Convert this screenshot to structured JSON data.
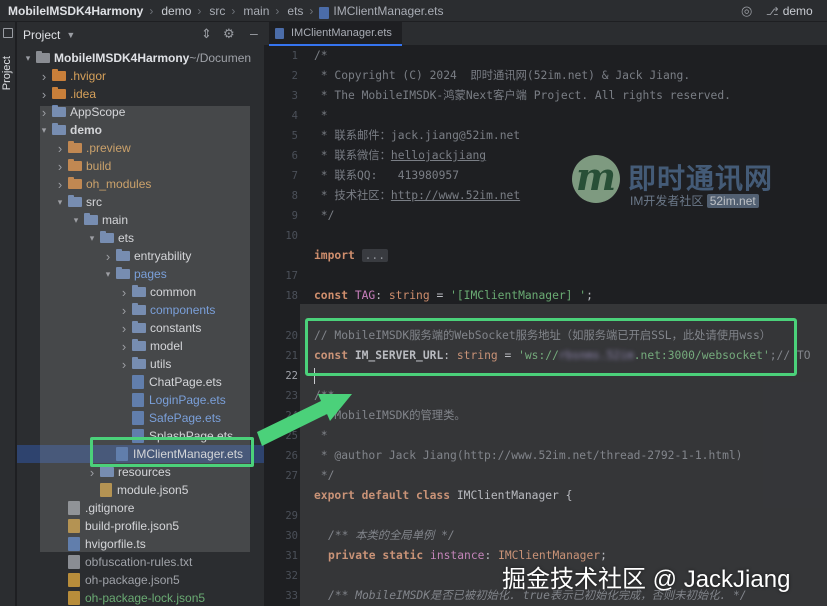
{
  "titlebar": {
    "project": "MobileIMSDK4Harmony",
    "crumbs": [
      "demo",
      "src",
      "main",
      "ets"
    ],
    "file": "IMClientManager.ets",
    "branch": "demo"
  },
  "toolstrip": {
    "project_label": "Project"
  },
  "project_panel": {
    "title": "Project",
    "root_name": "MobileIMSDK4Harmony",
    "root_path": "~/Documen"
  },
  "tree": [
    {
      "label": "MobileIMSDK4Harmony",
      "suffix": " ~/Documen",
      "depth": 0,
      "arrow": "v",
      "icon": "folder-gray",
      "color": "norm",
      "bold": true
    },
    {
      "label": ".hvigor",
      "depth": 1,
      "arrow": ">",
      "icon": "folder-orange",
      "color": "orange"
    },
    {
      "label": ".idea",
      "depth": 1,
      "arrow": ">",
      "icon": "folder-orange",
      "color": "orange"
    },
    {
      "label": "AppScope",
      "depth": 1,
      "arrow": ">",
      "icon": "folder-blue",
      "color": "norm"
    },
    {
      "label": "demo",
      "depth": 1,
      "arrow": "v",
      "icon": "folder-blue",
      "color": "norm",
      "bold": true
    },
    {
      "label": ".preview",
      "depth": 2,
      "arrow": ">",
      "icon": "folder-orange",
      "color": "orange"
    },
    {
      "label": "build",
      "depth": 2,
      "arrow": ">",
      "icon": "folder-orange",
      "color": "orange"
    },
    {
      "label": "oh_modules",
      "depth": 2,
      "arrow": ">",
      "icon": "folder-orange",
      "color": "orange"
    },
    {
      "label": "src",
      "depth": 2,
      "arrow": "v",
      "icon": "folder-blue",
      "color": "norm"
    },
    {
      "label": "main",
      "depth": 3,
      "arrow": "v",
      "icon": "folder-blue",
      "color": "norm"
    },
    {
      "label": "ets",
      "depth": 4,
      "arrow": "v",
      "icon": "folder-blue",
      "color": "norm"
    },
    {
      "label": "entryability",
      "depth": 5,
      "arrow": ">",
      "icon": "folder-blue",
      "color": "norm"
    },
    {
      "label": "pages",
      "depth": 5,
      "arrow": "v",
      "icon": "folder-blue",
      "color": "blue"
    },
    {
      "label": "common",
      "depth": 6,
      "arrow": ">",
      "icon": "folder-blue",
      "color": "norm"
    },
    {
      "label": "components",
      "depth": 6,
      "arrow": ">",
      "icon": "folder-blue",
      "color": "blue"
    },
    {
      "label": "constants",
      "depth": 6,
      "arrow": ">",
      "icon": "folder-blue",
      "color": "norm"
    },
    {
      "label": "model",
      "depth": 6,
      "arrow": ">",
      "icon": "folder-blue",
      "color": "norm"
    },
    {
      "label": "utils",
      "depth": 6,
      "arrow": ">",
      "icon": "folder-blue",
      "color": "norm"
    },
    {
      "label": "ChatPage.ets",
      "depth": 6,
      "arrow": "",
      "icon": "file-ets",
      "color": "norm"
    },
    {
      "label": "LoginPage.ets",
      "depth": 6,
      "arrow": "",
      "icon": "file-ets",
      "color": "blue"
    },
    {
      "label": "SafePage.ets",
      "depth": 6,
      "arrow": "",
      "icon": "file-ets",
      "color": "blue"
    },
    {
      "label": "SplashPage.ets",
      "depth": 6,
      "arrow": "",
      "icon": "file-ets",
      "color": "norm"
    },
    {
      "label": "IMClientManager.ets",
      "depth": 5,
      "arrow": "",
      "icon": "file-ets",
      "color": "norm"
    },
    {
      "label": "resources",
      "depth": 4,
      "arrow": ">",
      "icon": "folder-blue",
      "color": "norm"
    },
    {
      "label": "module.json5",
      "depth": 4,
      "arrow": "",
      "icon": "file-json",
      "color": "norm"
    },
    {
      "label": ".gitignore",
      "depth": 2,
      "arrow": "",
      "icon": "file-gray",
      "color": "norm"
    },
    {
      "label": "build-profile.json5",
      "depth": 2,
      "arrow": "",
      "icon": "file-json",
      "color": "norm"
    },
    {
      "label": "hvigorfile.ts",
      "depth": 2,
      "arrow": "",
      "icon": "file-ts",
      "color": "norm"
    },
    {
      "label": "obfuscation-rules.txt",
      "depth": 2,
      "arrow": "",
      "icon": "file-gray",
      "color": "dim"
    },
    {
      "label": "oh-package.json5",
      "depth": 2,
      "arrow": "",
      "icon": "file-json",
      "color": "dim"
    },
    {
      "label": "oh-package-lock.json5",
      "depth": 2,
      "arrow": "",
      "icon": "file-json",
      "color": "green"
    }
  ],
  "editor": {
    "tab_label": "IMClientManager.ets",
    "line_numbers": [
      "1",
      "2",
      "3",
      "4",
      "5",
      "6",
      "7",
      "8",
      "9",
      "10",
      "",
      "17",
      "18",
      "",
      "20",
      "21",
      "22",
      "23",
      "24",
      "25",
      "26",
      "27",
      "",
      "29",
      "30",
      "31",
      "32",
      "33"
    ],
    "current_line": "22",
    "lines": {
      "l1": "/*",
      "l2": " * Copyright (C) 2024  即时通讯网(52im.net) & Jack Jiang.",
      "l3": " * The MobileIMSDK-鸿蒙Next客户端 Project. All rights reserved.",
      "l4": " *",
      "l5a": " * 联系邮件：jack.jiang@52im.net",
      "l6a": " * 联系微信：",
      "l6b": "hellojackjiang",
      "l7": " * 联系QQ:   413980957",
      "l8a": " * 技术社区：",
      "l8b": "http://www.52im.net",
      "l9": " */",
      "l11a": "import",
      "l11b": "...",
      "l13a": "const",
      "l13b": "TAG",
      "l13c": "string",
      "l13d": "'[IMClientManager] '",
      "l15": "// MobileIMSDK服务端的WebSocket服务地址（如服务端已开启SSL，此处请使用wss）",
      "l16a": "const",
      "l16b": "IM_SERVER_URL",
      "l16c": "string",
      "l16d": "'ws://",
      "l16e": "rbsnms.52im",
      "l16f": ".net:3000/websocket'",
      "l16g": ";// TO",
      "l18": "/**",
      "l19": " * MobileIMSDK的管理类。",
      "l20": " *",
      "l21": " * @author Jack Jiang(http://www.52im.net/thread-2792-1-1.html)",
      "l22": " */",
      "l23a": "export default class",
      "l23b": "IMClientManager",
      "l25": "/** 本类的全局单例 */",
      "l26a": "private static",
      "l26b": "instance",
      "l26c": "IMClientManager",
      "l28": "/** MobileIMSDK是否已被初始化. true表示已初始化完成，否则未初始化. */"
    }
  },
  "watermark": {
    "logo_letter": "m",
    "logo_title": "即时通讯网",
    "logo_sub": "IM开发者社区",
    "logo_sub_box": "52im.net",
    "juejin": "掘金技术社区 @ JackJiang"
  },
  "colors": {
    "highlight": "#4bd17a",
    "accent": "#3574f0",
    "comment": "#7a7e85",
    "keyword": "#cf8e6d",
    "string": "#6aab73",
    "constant": "#c77dbb"
  }
}
